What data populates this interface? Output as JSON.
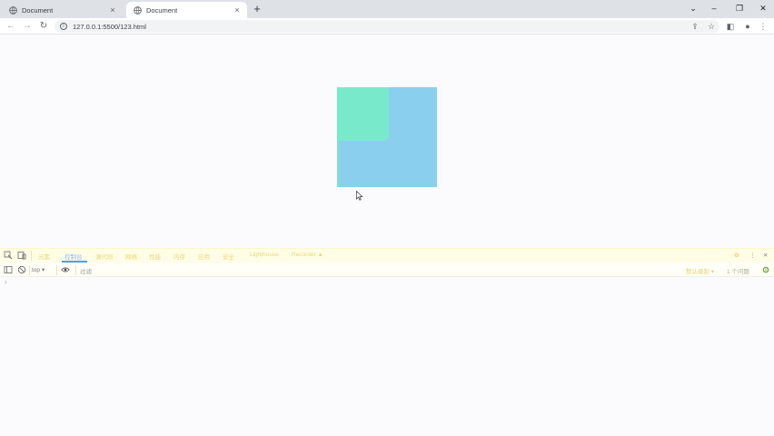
{
  "browser": {
    "tabs": [
      {
        "title": "Document",
        "close": "×"
      },
      {
        "title": "Document",
        "close": "×"
      }
    ],
    "new_tab": "+",
    "window_controls": {
      "caret": "⌄",
      "minimize": "–",
      "restore": "❐",
      "close": "✕"
    },
    "nav": {
      "back": "←",
      "forward": "→",
      "reload": "↻"
    },
    "address": {
      "info": "i",
      "url": "127.0.0.1:5500/123.html"
    },
    "toolbar_icons": {
      "share": "⇪",
      "bookmark": "☆",
      "sidebar": "◧",
      "profile": "●",
      "menu": "⋮"
    }
  },
  "page": {
    "colors": {
      "large_square": "#8ad0ee",
      "small_square": "#78eacb"
    }
  },
  "devtools": {
    "tabs": [
      "元素",
      "控制台",
      "源代码",
      "网络",
      "性能",
      "内存",
      "应用",
      "安全",
      "Lighthouse",
      "Recorder ▲"
    ],
    "active_tab": "控制台",
    "context": "top ▾",
    "filter_placeholder": "过滤",
    "levels": "默认级别 ▾",
    "issues": "1 个问题",
    "console_prompt": "›",
    "right_icons": {
      "settings": "⚙",
      "more": "⋮",
      "close": "✕"
    }
  }
}
